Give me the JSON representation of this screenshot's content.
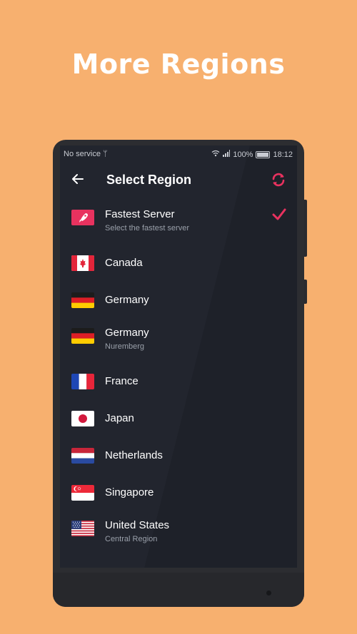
{
  "headline": "More Regions",
  "status": {
    "left": "No service",
    "battery": "100%",
    "time": "18:12"
  },
  "appbar": {
    "title": "Select Region",
    "back_icon": "arrow-left-icon",
    "refresh_icon": "refresh-icon"
  },
  "regions": [
    {
      "name": "Fastest Server",
      "subtitle": "Select the fastest server",
      "flag": "rocket",
      "selected": true
    },
    {
      "name": "Canada",
      "flag": "ca"
    },
    {
      "name": "Germany",
      "flag": "de"
    },
    {
      "name": "Germany",
      "subtitle": "Nuremberg",
      "flag": "de"
    },
    {
      "name": "France",
      "flag": "fr"
    },
    {
      "name": "Japan",
      "flag": "jp"
    },
    {
      "name": "Netherlands",
      "flag": "nl"
    },
    {
      "name": "Singapore",
      "flag": "sg"
    },
    {
      "name": "United States",
      "subtitle": "Central Region",
      "flag": "us"
    }
  ],
  "colors": {
    "background": "#F7B06F",
    "accent": "#E8325F",
    "screen": "#22252E"
  }
}
